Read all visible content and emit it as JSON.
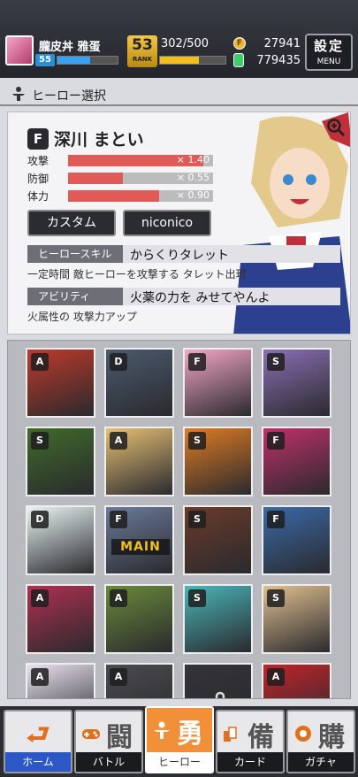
{
  "player": {
    "name": "朧皮丼 雅蛋",
    "level": "55",
    "level_progress": 0.55,
    "rank": "53",
    "rank_label": "RANK",
    "stamina": "302/500",
    "stamina_progress": 0.6,
    "coins": "27941",
    "gems": "779435"
  },
  "menu": {
    "label": "設定",
    "sub": "MENU"
  },
  "section": {
    "title": "ヒーロー選択"
  },
  "hero": {
    "class_glyph": "F",
    "name": "深川 まとい",
    "stats": [
      {
        "label": "攻撃",
        "value": "× 1.40",
        "fill": 0.93
      },
      {
        "label": "防御",
        "value": "× 0.55",
        "fill": 0.38
      },
      {
        "label": "体力",
        "value": "× 0.90",
        "fill": 0.63
      }
    ],
    "custom_label": "カスタム",
    "niconico_label": "niconico",
    "skill_tag": "ヒーロースキル",
    "skill_name": "からくりタレット",
    "skill_desc": "一定時間 敵ヒーローを攻撃する タレット出現",
    "ability_tag": "アビリティ",
    "ability_name": "火薬の力を みせてやんよ",
    "ability_desc": "火属性の 攻撃力アップ"
  },
  "grid": {
    "main_label": "MAIN",
    "cells": [
      {
        "cls": "A",
        "color": "#c0392b"
      },
      {
        "cls": "D",
        "color": "#4b5a6e"
      },
      {
        "cls": "F",
        "color": "#f4a6c6"
      },
      {
        "cls": "S",
        "color": "#8a6fb3"
      },
      {
        "cls": "S",
        "color": "#3f6b2a"
      },
      {
        "cls": "A",
        "color": "#e6c074"
      },
      {
        "cls": "S",
        "color": "#e07b22"
      },
      {
        "cls": "F",
        "color": "#c0306a"
      },
      {
        "cls": "D",
        "color": "#e8f4f2"
      },
      {
        "cls": "F",
        "color": "#6b7b9a"
      },
      {
        "cls": "S",
        "color": "#6a3b2a"
      },
      {
        "cls": "F",
        "color": "#3a6aa8"
      },
      {
        "cls": "A",
        "color": "#b03050"
      },
      {
        "cls": "A",
        "color": "#6a8a3a"
      },
      {
        "cls": "S",
        "color": "#49b6b8"
      },
      {
        "cls": "S",
        "color": "#e0c090"
      },
      {
        "cls": "A",
        "color": "#e8e2ee"
      },
      {
        "cls": "A",
        "color": "#4a4a50"
      },
      {
        "cls": "",
        "color": "#333338"
      },
      {
        "cls": "A",
        "color": "#c0242a"
      }
    ]
  },
  "nav": [
    {
      "kanji": "⮐",
      "label": "ホーム"
    },
    {
      "kanji": "闘",
      "label": "バトル"
    },
    {
      "kanji": "勇",
      "label": "ヒーロー"
    },
    {
      "kanji": "備",
      "label": "カード"
    },
    {
      "kanji": "購",
      "label": "ガチャ"
    }
  ],
  "colors": {
    "accent": "#f2903a",
    "stat_bar": "#e05a57",
    "home_blue": "#2b58c4"
  }
}
